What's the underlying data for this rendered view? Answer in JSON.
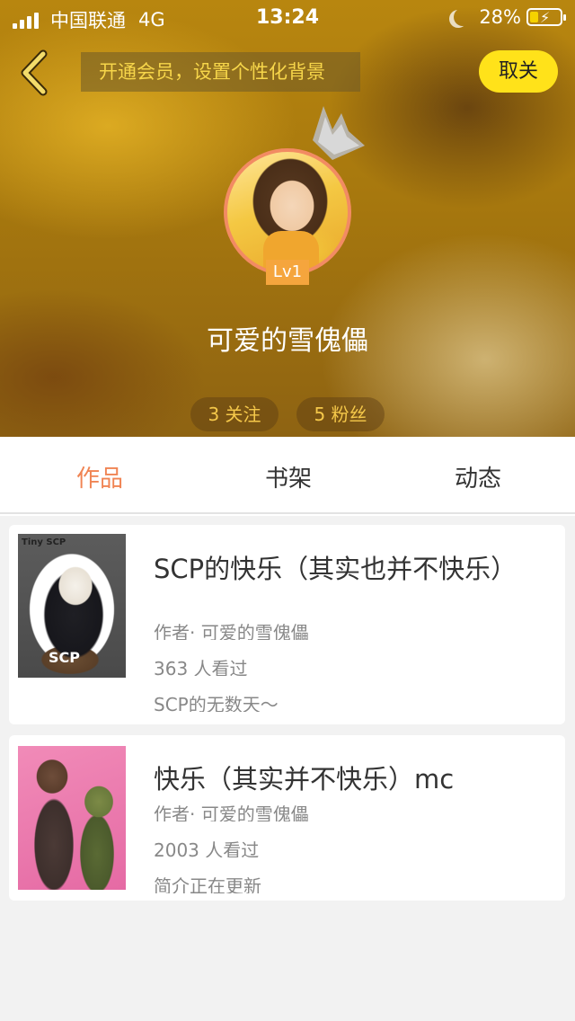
{
  "status_bar": {
    "carrier": "中国联通",
    "network": "4G",
    "time": "13:24",
    "battery": "28%",
    "battery_level": 0.28
  },
  "header": {
    "vip_banner": "开通会员，设置个性化背景",
    "cancel_label": "取关"
  },
  "profile": {
    "level": "Lv1",
    "username": "可爱的雪傀儡",
    "following": "3 关注",
    "fans": "5 粉丝"
  },
  "tabs": [
    {
      "label": "作品",
      "active": true
    },
    {
      "label": "书架",
      "active": false
    },
    {
      "label": "动态",
      "active": false
    }
  ],
  "works": [
    {
      "title": "SCP的快乐（其实也并不快乐）",
      "author": "作者· 可爱的雪傀儡",
      "views": "363 人看过",
      "intro": "SCP的无数天～",
      "cover_text": "Tiny SCP",
      "cover_badge": "SCP"
    },
    {
      "title": "快乐（其实并不快乐）mc",
      "author": "作者· 可爱的雪傀儡",
      "views": "2003 人看过",
      "intro": "简介正在更新"
    }
  ],
  "colors": {
    "accent": "#f08453",
    "cancel_button": "#ffe21a",
    "vip_text": "#f7d64a",
    "level_badge": "#f5a53d",
    "pill_text": "#f5c84a"
  },
  "icons": {
    "back": "chevron-left-icon",
    "signal": "signal-bars-icon",
    "moon": "moon-icon",
    "battery": "battery-charging-icon",
    "crown": "crown-icon"
  }
}
